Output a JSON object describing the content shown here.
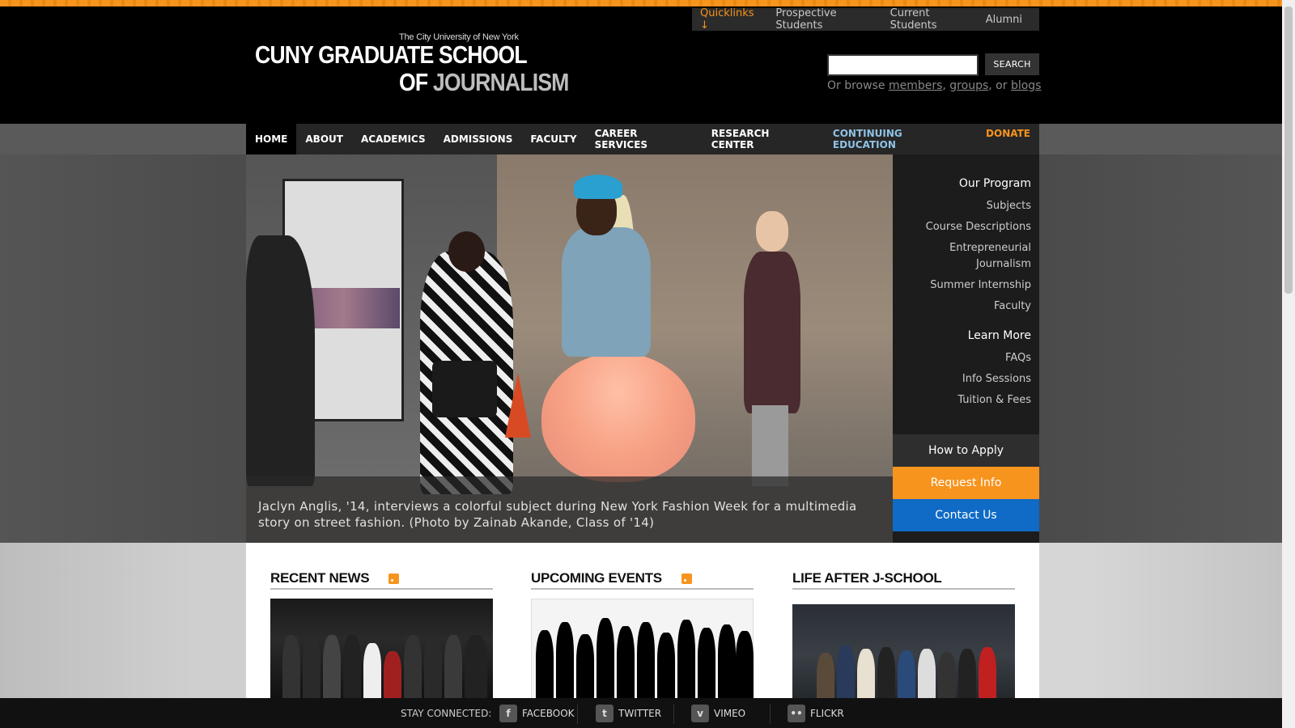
{
  "quicklinks": {
    "label": "Quicklinks ↓",
    "items": [
      "Prospective Students",
      "Current Students",
      "Alumni"
    ]
  },
  "logo": {
    "small": "The City University of New York",
    "line1": "CUNY GRADUATE SCHOOL",
    "line2a": "OF ",
    "line2b": "JOURNALISM"
  },
  "search": {
    "placeholder": "",
    "button": "SEARCH",
    "browse_prefix": "Or browse ",
    "members": "members",
    "groups": "groups",
    "or": ", or ",
    "blogs": "blogs",
    "comma": ", "
  },
  "nav": {
    "items": [
      "HOME",
      "ABOUT",
      "ACADEMICS",
      "ADMISSIONS",
      "FACULTY",
      "CAREER SERVICES",
      "RESEARCH CENTER"
    ],
    "continuing": "CONTINUING EDUCATION",
    "donate": "DONATE"
  },
  "hero": {
    "caption": "Jaclyn Anglis, '14, interviews a colorful subject during New York Fashion Week for a multimedia story on street fashion. (Photo by Zainab Akande, Class of '14)"
  },
  "sidebar": {
    "program_title": "Our Program",
    "program_links": [
      "Subjects",
      "Course Descriptions",
      "Entrepreneurial Journalism",
      "Summer Internship",
      "Faculty"
    ],
    "learn_title": "Learn More",
    "learn_links": [
      "FAQs",
      "Info Sessions",
      "Tuition & Fees"
    ],
    "apply": "How to Apply",
    "request": "Request Info",
    "contact": "Contact Us"
  },
  "columns": {
    "news": "RECENT NEWS",
    "events": "UPCOMING EVENTS",
    "life": "LIFE AFTER J-SCHOOL"
  },
  "footer": {
    "stay": "STAY CONNECTED:",
    "facebook": "FACEBOOK",
    "twitter": "TWITTER",
    "vimeo": "VIMEO",
    "flickr": "FLICKR"
  },
  "colors": {
    "accent": "#f7941d",
    "contact_blue": "#0f6bc6",
    "continuing_blue": "#8fc3e6"
  }
}
